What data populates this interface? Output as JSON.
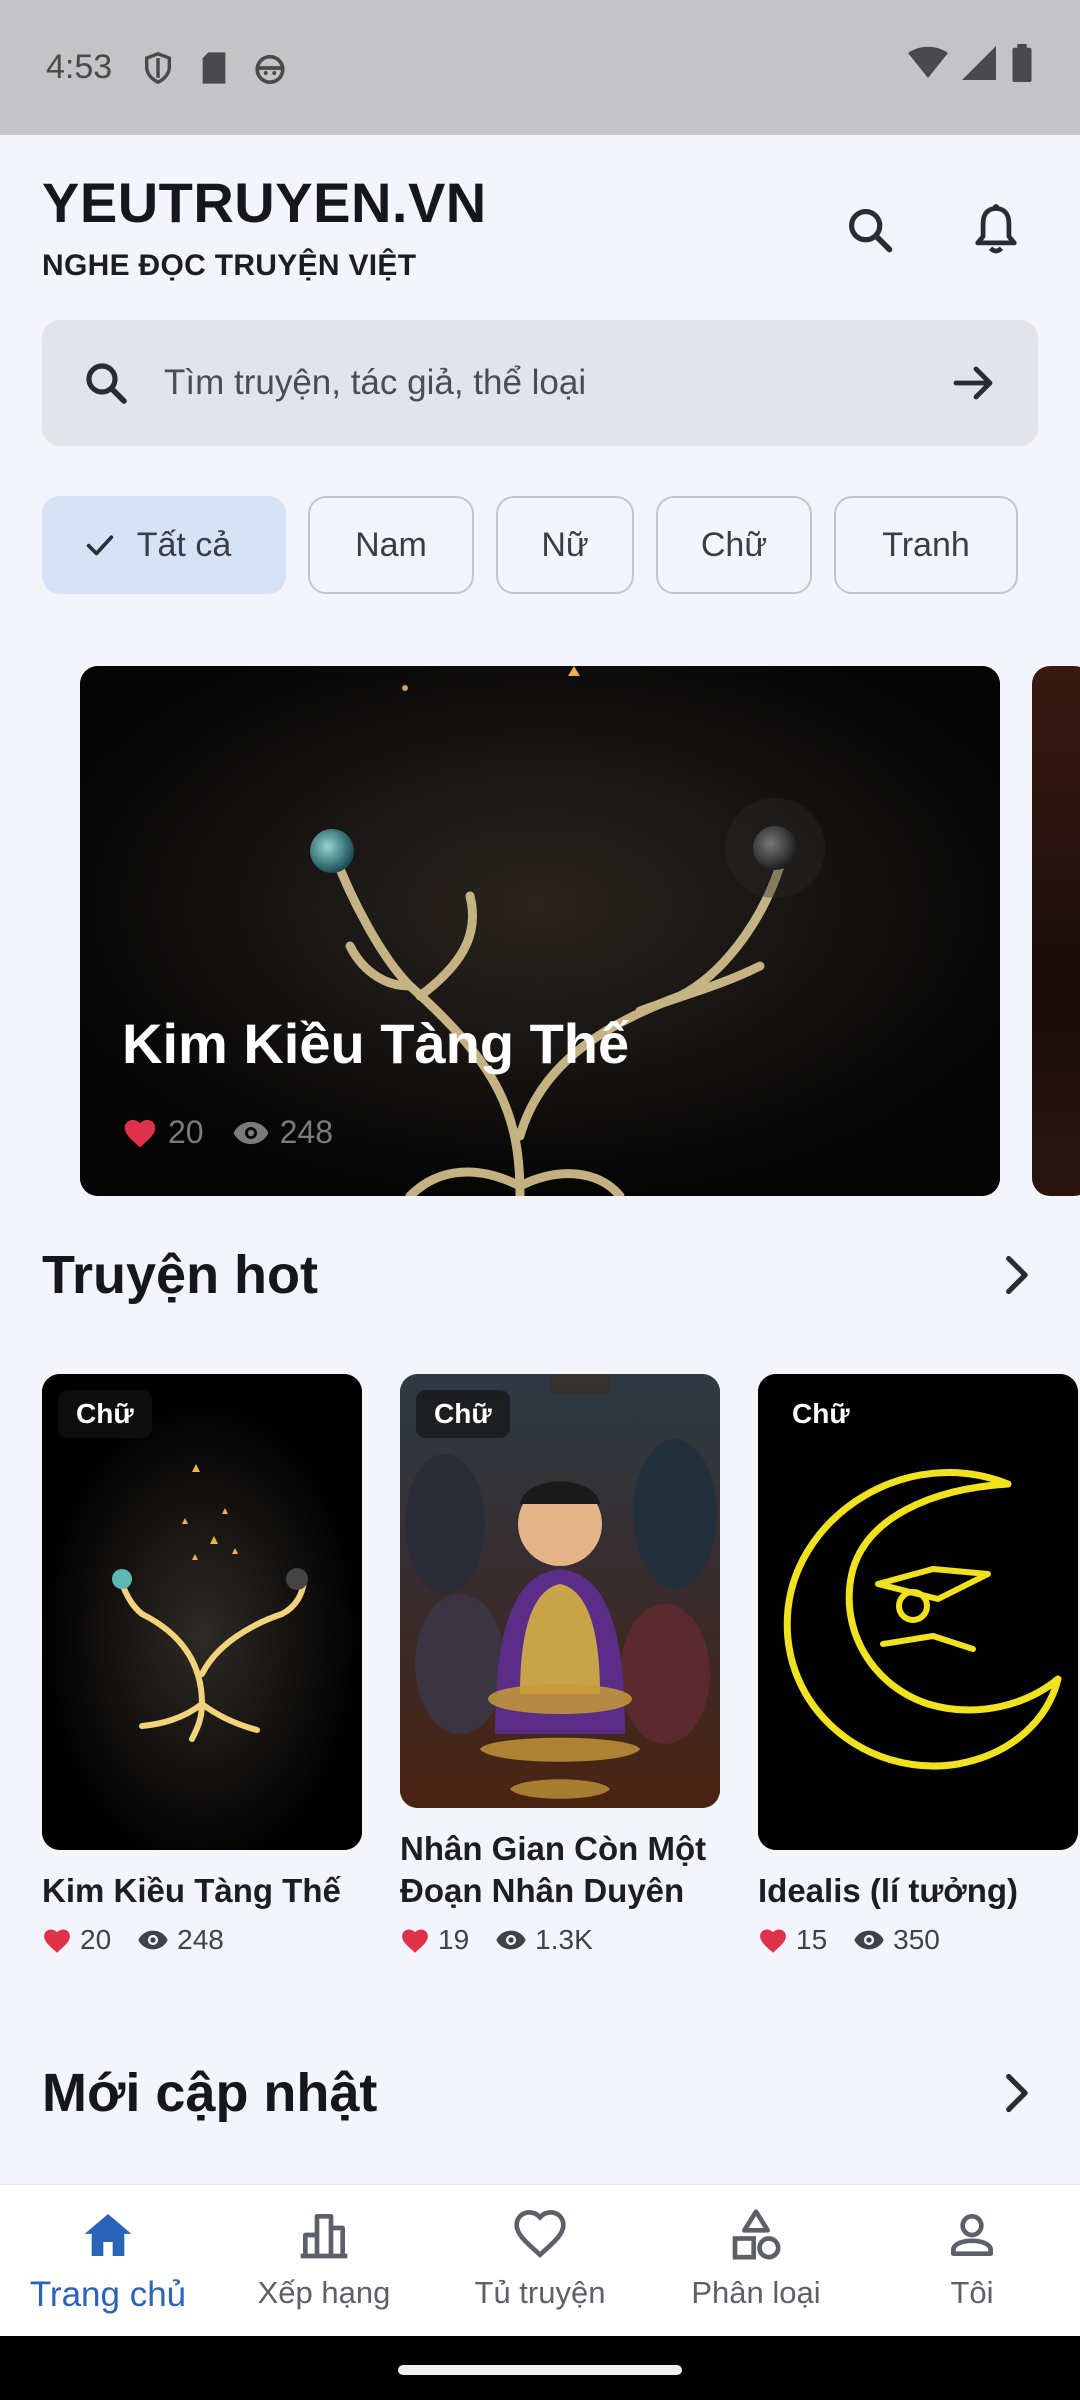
{
  "status_bar": {
    "time": "4:53"
  },
  "header": {
    "brand": "YEUTRUYEN.VN",
    "tagline": "NGHE ĐỌC TRUYỆN VIỆT"
  },
  "search": {
    "placeholder": "Tìm truyện, tác giả, thể loại"
  },
  "filters": [
    {
      "label": "Tất cả",
      "selected": true
    },
    {
      "label": "Nam",
      "selected": false
    },
    {
      "label": "Nữ",
      "selected": false
    },
    {
      "label": "Chữ",
      "selected": false
    },
    {
      "label": "Tranh",
      "selected": false
    }
  ],
  "banner": {
    "title": "Kim Kiều Tàng Thế",
    "likes": "20",
    "views": "248"
  },
  "hot_section": {
    "title": "Truyện hot",
    "items": [
      {
        "tag": "Chữ",
        "title": "Kim Kiều Tàng Thế",
        "likes": "20",
        "views": "248"
      },
      {
        "tag": "Chữ",
        "title": "Nhân Gian Còn Một Đoạn Nhân Duyên",
        "likes": "19",
        "views": "1.3K"
      },
      {
        "tag": "Chữ",
        "title": "Idealis (lí tưởng)",
        "likes": "15",
        "views": "350"
      }
    ]
  },
  "updated_section": {
    "title": "Mới cập nhật"
  },
  "bottom_nav": [
    {
      "label": "Trang chủ",
      "icon": "home-icon",
      "active": true
    },
    {
      "label": "Xếp hạng",
      "icon": "ranking-icon",
      "active": false
    },
    {
      "label": "Tủ truyện",
      "icon": "heart-icon",
      "active": false
    },
    {
      "label": "Phân loại",
      "icon": "category-icon",
      "active": false
    },
    {
      "label": "Tôi",
      "icon": "person-icon",
      "active": false
    }
  ],
  "colors": {
    "accent": "#2a64b8",
    "chip_selected": "#d6e3f7",
    "like": "#e0314b"
  }
}
